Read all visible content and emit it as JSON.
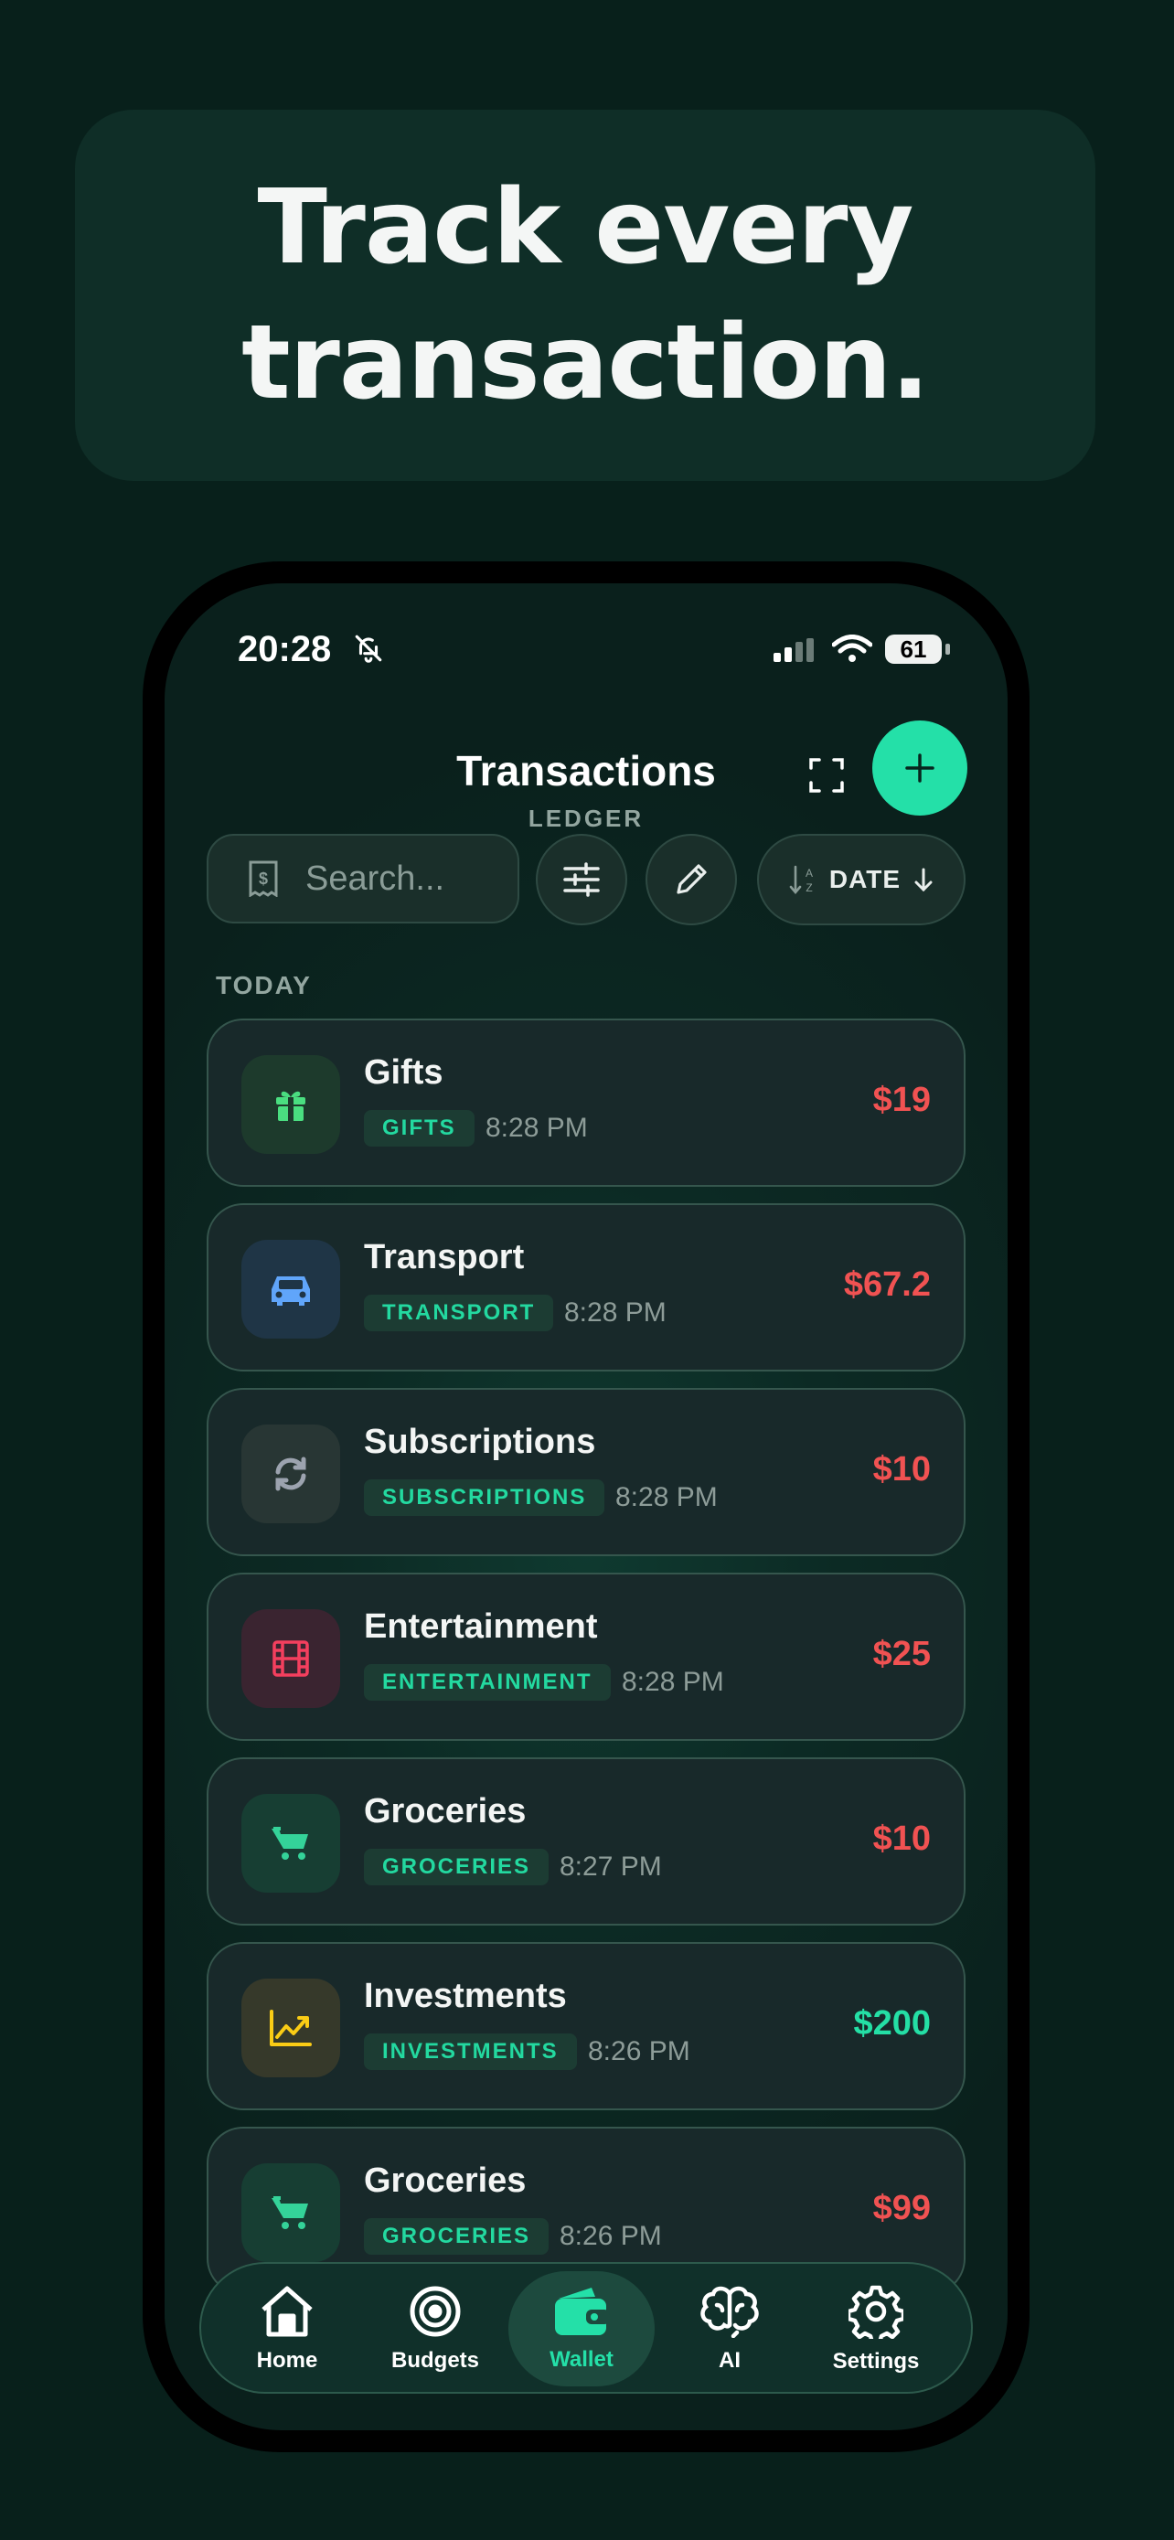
{
  "hero": {
    "line1": "Track every",
    "line2": "transaction."
  },
  "status_bar": {
    "time": "20:28",
    "battery": "61"
  },
  "header": {
    "title": "Transactions",
    "subtitle": "LEDGER"
  },
  "search": {
    "placeholder": "Search..."
  },
  "sort": {
    "label": "DATE"
  },
  "section": "TODAY",
  "transactions": [
    {
      "name": "Gifts",
      "tag": "GIFTS",
      "time": "8:28 PM",
      "amount": "$19",
      "type": "expense",
      "icon": "gift-icon",
      "color": "#4ade80"
    },
    {
      "name": "Transport",
      "tag": "TRANSPORT",
      "time": "8:28 PM",
      "amount": "$67.2",
      "type": "expense",
      "icon": "car-icon",
      "color": "#60a5fa"
    },
    {
      "name": "Subscriptions",
      "tag": "SUBSCRIPTIONS",
      "time": "8:28 PM",
      "amount": "$10",
      "type": "expense",
      "icon": "refresh-icon",
      "color": "#9ca3af"
    },
    {
      "name": "Entertainment",
      "tag": "ENTERTAINMENT",
      "time": "8:28 PM",
      "amount": "$25",
      "type": "expense",
      "icon": "film-icon",
      "color": "#f43f5e"
    },
    {
      "name": "Groceries",
      "tag": "GROCERIES",
      "time": "8:27 PM",
      "amount": "$10",
      "type": "expense",
      "icon": "cart-icon",
      "color": "#34d399"
    },
    {
      "name": "Investments",
      "tag": "INVESTMENTS",
      "time": "8:26 PM",
      "amount": "$200",
      "type": "income",
      "icon": "chart-up-icon",
      "color": "#facc15"
    },
    {
      "name": "Groceries",
      "tag": "GROCERIES",
      "time": "8:26 PM",
      "amount": "$99",
      "type": "expense",
      "icon": "cart-icon",
      "color": "#34d399"
    }
  ],
  "tabs": [
    {
      "label": "Home",
      "icon": "home-icon",
      "active": false
    },
    {
      "label": "Budgets",
      "icon": "target-icon",
      "active": false
    },
    {
      "label": "Wallet",
      "icon": "wallet-icon",
      "active": true
    },
    {
      "label": "AI",
      "icon": "brain-icon",
      "active": false
    },
    {
      "label": "Settings",
      "icon": "gear-icon",
      "active": false
    }
  ],
  "colors": {
    "accent": "#24e0a8",
    "expense": "#f05252",
    "income": "#24dfa5",
    "background": "#08201b"
  }
}
